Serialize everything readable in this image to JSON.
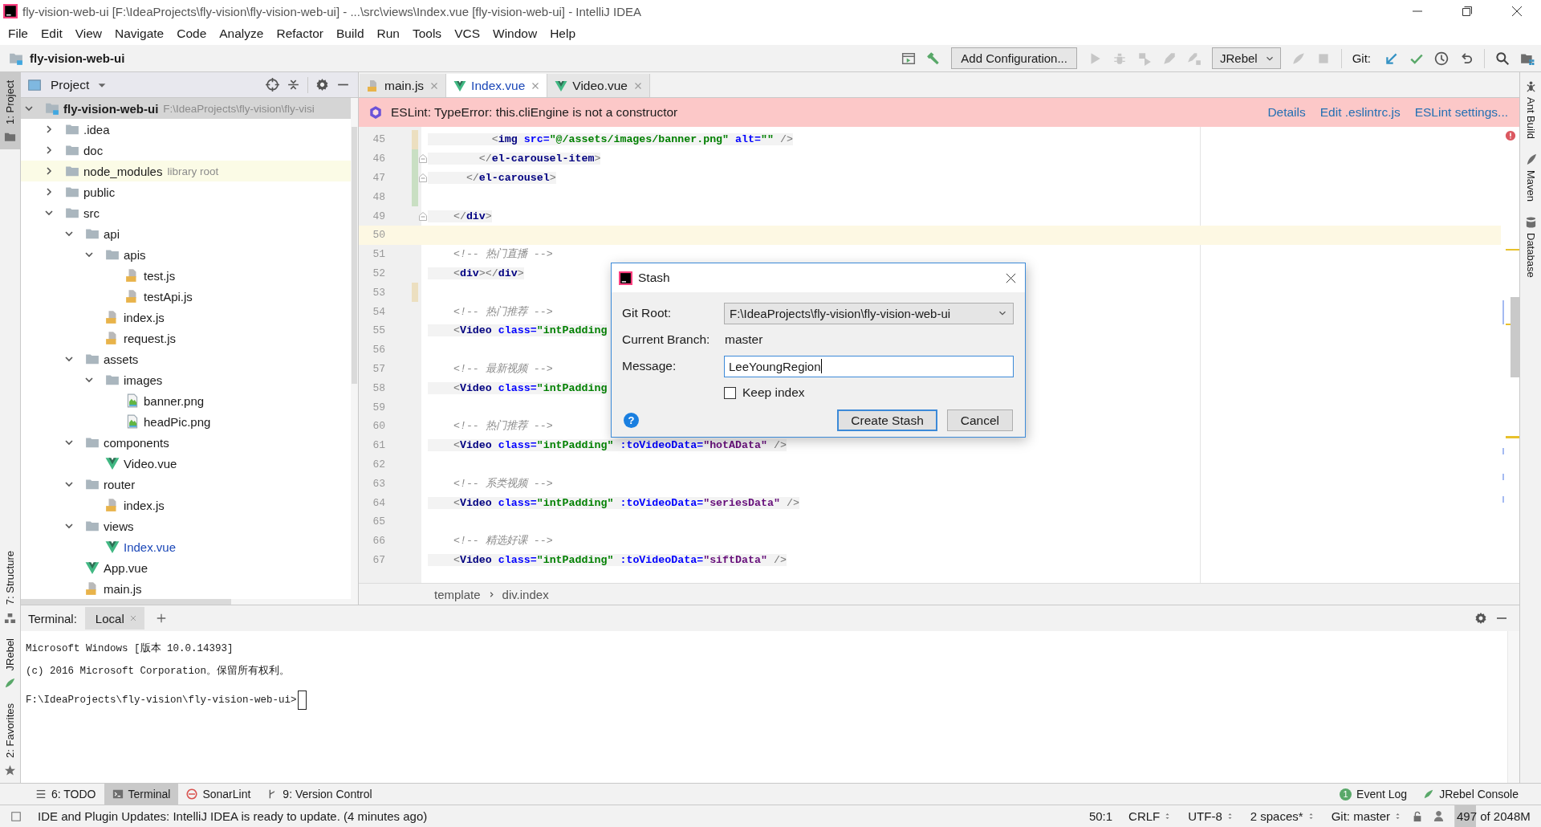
{
  "window": {
    "title": "fly-vision-web-ui [F:\\IdeaProjects\\fly-vision\\fly-vision-web-ui] - ...\\src\\views\\Index.vue [fly-vision-web-ui] - IntelliJ IDEA"
  },
  "menu": [
    "File",
    "Edit",
    "View",
    "Navigate",
    "Code",
    "Analyze",
    "Refactor",
    "Build",
    "Run",
    "Tools",
    "VCS",
    "Window",
    "Help"
  ],
  "nav_bar": {
    "project": "fly-vision-web-ui"
  },
  "toolbar": {
    "items": [
      {
        "kind": "window",
        "disabled": false
      },
      {
        "kind": "hammer",
        "disabled": false
      },
      {
        "kind": "config-button",
        "label": "Add Configuration..."
      },
      {
        "kind": "run",
        "disabled": true
      },
      {
        "kind": "debug",
        "disabled": true
      },
      {
        "kind": "coverage",
        "disabled": true
      },
      {
        "kind": "rocket",
        "disabled": true
      },
      {
        "kind": "rocket-bug",
        "disabled": true
      },
      {
        "kind": "dropdown",
        "label": "JRebel"
      },
      {
        "kind": "leaf",
        "disabled": true
      },
      {
        "kind": "stop",
        "disabled": true
      },
      {
        "kind": "label",
        "text": "Git:"
      },
      {
        "kind": "vcs-update",
        "disabled": false
      },
      {
        "kind": "commit",
        "disabled": false
      },
      {
        "kind": "history",
        "disabled": false
      },
      {
        "kind": "rollback",
        "disabled": false
      },
      {
        "kind": "search",
        "disabled": false
      },
      {
        "kind": "structure",
        "disabled": false
      }
    ]
  },
  "left_tools_top": [
    {
      "label": "1: Project",
      "kind": "project",
      "selected": true
    }
  ],
  "left_tools_bottom": [
    {
      "label": "7: Structure",
      "kind": "structure-tool",
      "selected": false
    },
    {
      "label": "JRebel",
      "kind": "jrebel",
      "selected": false
    },
    {
      "label": "2: Favorites",
      "kind": "favorites",
      "selected": false
    }
  ],
  "right_tools": [
    {
      "label": "Ant Build",
      "kind": "ant"
    },
    {
      "label": "Maven",
      "kind": "maven"
    },
    {
      "label": "Database",
      "kind": "database"
    }
  ],
  "project_panel": {
    "title": "Project",
    "tree": [
      {
        "name": "fly-vision-web-ui",
        "hint": "F:\\IdeaProjects\\fly-vision\\fly-visi",
        "kind": "module",
        "expanded": true,
        "selected": true,
        "children": [
          {
            "name": ".idea",
            "kind": "folder",
            "expanded": false,
            "selected": false
          },
          {
            "name": "doc",
            "kind": "folder",
            "expanded": false,
            "selected": false
          },
          {
            "name": "node_modules",
            "hint": "library root",
            "kind": "library-folder",
            "expanded": false,
            "selected": false
          },
          {
            "name": "public",
            "kind": "folder",
            "expanded": false,
            "selected": false
          },
          {
            "name": "src",
            "kind": "folder",
            "expanded": true,
            "selected": false,
            "children": [
              {
                "name": "api",
                "kind": "folder",
                "expanded": true,
                "selected": false,
                "children": [
                  {
                    "name": "apis",
                    "kind": "folder",
                    "expanded": true,
                    "selected": false,
                    "children": [
                      {
                        "name": "test.js",
                        "kind": "js",
                        "selected": false,
                        "modified": false
                      },
                      {
                        "name": "testApi.js",
                        "kind": "js",
                        "selected": false,
                        "modified": false
                      }
                    ]
                  },
                  {
                    "name": "index.js",
                    "kind": "js",
                    "selected": false,
                    "modified": false
                  },
                  {
                    "name": "request.js",
                    "kind": "js",
                    "selected": false,
                    "modified": false
                  }
                ]
              },
              {
                "name": "assets",
                "kind": "folder",
                "expanded": true,
                "selected": false,
                "children": [
                  {
                    "name": "images",
                    "kind": "folder",
                    "expanded": true,
                    "selected": false,
                    "children": [
                      {
                        "name": "banner.png",
                        "kind": "png",
                        "selected": false,
                        "modified": false
                      },
                      {
                        "name": "headPic.png",
                        "kind": "png",
                        "selected": false,
                        "modified": false
                      }
                    ]
                  }
                ]
              },
              {
                "name": "components",
                "kind": "folder",
                "expanded": true,
                "selected": false,
                "children": [
                  {
                    "name": "Video.vue",
                    "kind": "vue",
                    "selected": false,
                    "modified": false
                  }
                ]
              },
              {
                "name": "router",
                "kind": "folder",
                "expanded": true,
                "selected": false,
                "children": [
                  {
                    "name": "index.js",
                    "kind": "js",
                    "selected": false,
                    "modified": false
                  }
                ]
              },
              {
                "name": "views",
                "kind": "folder",
                "expanded": true,
                "selected": false,
                "children": [
                  {
                    "name": "Index.vue",
                    "kind": "vue",
                    "selected": false,
                    "modified": true
                  }
                ]
              },
              {
                "name": "App.vue",
                "kind": "vue",
                "selected": false,
                "modified": false
              },
              {
                "name": "main.js",
                "kind": "js",
                "selected": false,
                "modified": false
              }
            ]
          }
        ]
      }
    ]
  },
  "editor": {
    "tabs": [
      {
        "label": "main.js",
        "kind": "js",
        "selected": false,
        "modified": false
      },
      {
        "label": "Index.vue",
        "kind": "vue",
        "selected": true,
        "modified": true
      },
      {
        "label": "Video.vue",
        "kind": "vue",
        "selected": false,
        "modified": false
      }
    ],
    "banner": {
      "message": "ESLint: TypeError: this.cliEngine is not a constructor",
      "links": [
        "Details",
        "Edit .eslintrc.js",
        "ESLint settings..."
      ]
    },
    "lines": [
      {
        "number": "45",
        "change": {
          "color": "#ecdfc0"
        },
        "fold": false,
        "current": false,
        "tokens": [
          {
            "kind": "punct",
            "text": "          <"
          },
          {
            "kind": "tag",
            "text": "img"
          },
          {
            "kind": "attr",
            "text": " src="
          },
          {
            "kind": "str",
            "text": "\"@/assets/images/banner.png\""
          },
          {
            "kind": "attr",
            "text": " alt="
          },
          {
            "kind": "str",
            "text": "\"\""
          },
          {
            "kind": "punct",
            "text": " />"
          }
        ]
      },
      {
        "number": "46",
        "change": {
          "color": "#c9dfc3"
        },
        "fold": true,
        "current": false,
        "tokens": [
          {
            "kind": "punct",
            "text": "        </"
          },
          {
            "kind": "tag",
            "text": "el-carousel-item"
          },
          {
            "kind": "punct",
            "text": ">"
          }
        ]
      },
      {
        "number": "47",
        "change": {
          "color": "#c9dfc3"
        },
        "fold": true,
        "current": false,
        "tokens": [
          {
            "kind": "punct",
            "text": "      </"
          },
          {
            "kind": "tag",
            "text": "el-carousel"
          },
          {
            "kind": "punct",
            "text": ">"
          }
        ]
      },
      {
        "number": "48",
        "change": {
          "color": "#c9dfc3"
        },
        "fold": false,
        "current": false
      },
      {
        "number": "49",
        "fold": true,
        "current": false,
        "tokens": [
          {
            "kind": "punct",
            "text": "    </"
          },
          {
            "kind": "tag",
            "text": "div"
          },
          {
            "kind": "punct",
            "text": ">"
          }
        ]
      },
      {
        "number": "50",
        "fold": false,
        "current": true
      },
      {
        "number": "51",
        "fold": false,
        "current": false,
        "tokens": [
          {
            "kind": "comment",
            "text": "    <!-- 热门直播 -->"
          }
        ]
      },
      {
        "number": "52",
        "fold": false,
        "current": false,
        "tokens": [
          {
            "kind": "punct",
            "text": "    <"
          },
          {
            "kind": "tag",
            "text": "div"
          },
          {
            "kind": "punct",
            "text": "></"
          },
          {
            "kind": "tag",
            "text": "div"
          },
          {
            "kind": "punct",
            "text": ">"
          }
        ]
      },
      {
        "number": "53",
        "change": {
          "color": "#ecdfc0"
        },
        "fold": false,
        "current": false
      },
      {
        "number": "54",
        "fold": false,
        "current": false,
        "tokens": [
          {
            "kind": "comment",
            "text": "    <!-- 热门推荐 -->"
          }
        ]
      },
      {
        "number": "55",
        "fold": false,
        "current": false,
        "tokens": [
          {
            "kind": "punct",
            "text": "    <"
          },
          {
            "kind": "tag",
            "text": "Video"
          },
          {
            "kind": "attr",
            "text": " class="
          },
          {
            "kind": "str",
            "text": "\"intPadding"
          }
        ]
      },
      {
        "number": "56",
        "fold": false,
        "current": false
      },
      {
        "number": "57",
        "fold": false,
        "current": false,
        "tokens": [
          {
            "kind": "comment",
            "text": "    <!-- 最新视频 -->"
          }
        ]
      },
      {
        "number": "58",
        "fold": false,
        "current": false,
        "tokens": [
          {
            "kind": "punct",
            "text": "    <"
          },
          {
            "kind": "tag",
            "text": "Video"
          },
          {
            "kind": "attr",
            "text": " class="
          },
          {
            "kind": "str",
            "text": "\"intPadding"
          }
        ]
      },
      {
        "number": "59",
        "fold": false,
        "current": false
      },
      {
        "number": "60",
        "fold": false,
        "current": false,
        "tokens": [
          {
            "kind": "comment",
            "text": "    <!-- 热门推荐 -->"
          }
        ]
      },
      {
        "number": "61",
        "fold": false,
        "current": false,
        "tokens": [
          {
            "kind": "punct",
            "text": "    <"
          },
          {
            "kind": "tag",
            "text": "Video"
          },
          {
            "kind": "attr",
            "text": " class="
          },
          {
            "kind": "str",
            "text": "\"intPadding\""
          },
          {
            "kind": "attr",
            "text": " :toVideoData="
          },
          {
            "kind": "val",
            "text": "\"hotAData\""
          },
          {
            "kind": "punct",
            "text": " />"
          }
        ]
      },
      {
        "number": "62",
        "fold": false,
        "current": false
      },
      {
        "number": "63",
        "fold": false,
        "current": false,
        "tokens": [
          {
            "kind": "comment",
            "text": "    <!-- 系类视频 -->"
          }
        ]
      },
      {
        "number": "64",
        "fold": false,
        "current": false,
        "tokens": [
          {
            "kind": "punct",
            "text": "    <"
          },
          {
            "kind": "tag",
            "text": "Video"
          },
          {
            "kind": "attr",
            "text": " class="
          },
          {
            "kind": "str",
            "text": "\"intPadding\""
          },
          {
            "kind": "attr",
            "text": " :toVideoData="
          },
          {
            "kind": "val",
            "text": "\"seriesData\""
          },
          {
            "kind": "punct",
            "text": " />"
          }
        ]
      },
      {
        "number": "65",
        "fold": false,
        "current": false
      },
      {
        "number": "66",
        "fold": false,
        "current": false,
        "tokens": [
          {
            "kind": "comment",
            "text": "    <!-- 精选好课 -->"
          }
        ]
      },
      {
        "number": "67",
        "fold": false,
        "current": false,
        "tokens": [
          {
            "kind": "punct",
            "text": "    <"
          },
          {
            "kind": "tag",
            "text": "Video"
          },
          {
            "kind": "attr",
            "text": " class="
          },
          {
            "kind": "str",
            "text": "\"intPadding\""
          },
          {
            "kind": "attr",
            "text": " :toVideoData="
          },
          {
            "kind": "val",
            "text": "\"siftData\""
          },
          {
            "kind": "punct",
            "text": " />"
          }
        ]
      }
    ],
    "breadcrumbs": [
      "template",
      "div.index"
    ]
  },
  "terminal": {
    "label": "Terminal:",
    "tabs": [
      {
        "label": "Local",
        "selected": true
      }
    ],
    "output": [
      "Microsoft Windows [版本 10.0.14393]",
      "(c) 2016 Microsoft Corporation。保留所有权利。"
    ],
    "prompt": "F:\\IdeaProjects\\fly-vision\\fly-vision-web-ui>"
  },
  "bottom_tools": [
    {
      "label": "6: TODO",
      "kind": "todo",
      "selected": false
    },
    {
      "label": "Terminal",
      "kind": "terminal",
      "selected": true
    },
    {
      "label": "SonarLint",
      "kind": "sonarlint",
      "selected": false
    },
    {
      "label": "9: Version Control",
      "kind": "vcs",
      "selected": false
    }
  ],
  "bottom_tools_right": [
    {
      "label": "Event Log",
      "kind": "event-log",
      "badge": "1"
    },
    {
      "label": "JRebel Console",
      "kind": "jrebel"
    }
  ],
  "status_bar": {
    "message": "IDE and Plugin Updates: IntelliJ IDEA is ready to update. (4 minutes ago)",
    "position": "50:1",
    "line_separator": "CRLF",
    "encoding": "UTF-8",
    "indent": "2 spaces*",
    "branch": "Git: master",
    "memory": {
      "text": "497 of 2048M",
      "level": 0.24
    }
  },
  "stash_dialog": {
    "title": "Stash",
    "git_root_label": "Git Root:",
    "git_root": "F:\\IdeaProjects\\fly-vision\\fly-vision-web-ui",
    "branch_label": "Current Branch:",
    "branch": "master",
    "message_label": "Message:",
    "message": "LeeYoungRegion",
    "keep_index": {
      "label": "Keep index",
      "checked": false
    },
    "help": "?",
    "buttons": [
      {
        "label": "Create Stash",
        "kind": "default"
      },
      {
        "label": "Cancel",
        "kind": "normal"
      }
    ]
  }
}
